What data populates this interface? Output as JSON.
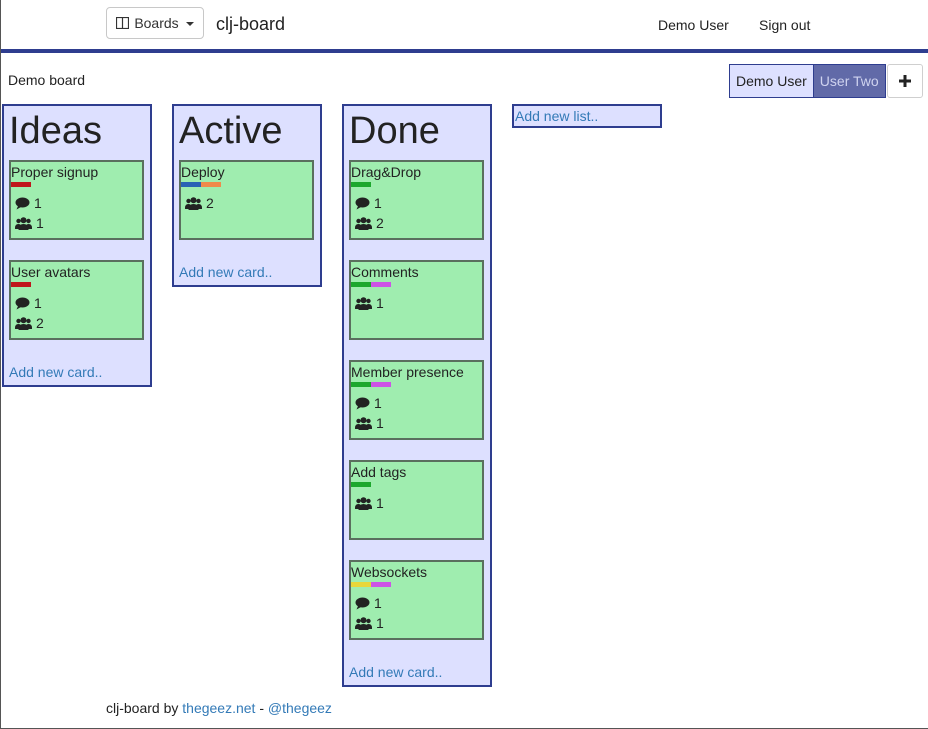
{
  "nav": {
    "boards_label": "Boards",
    "brand": "clj-board",
    "user_link": "Demo User",
    "signout_link": "Sign out"
  },
  "board": {
    "title": "Demo board",
    "members": [
      "Demo User",
      "User Two"
    ],
    "add_member_icon": "plus-icon",
    "add_list_label": "Add new list.."
  },
  "lists": [
    {
      "title": "Ideas",
      "add_card_label": "Add new card..",
      "cards": [
        {
          "title": "Proper signup",
          "tags": [
            "#c0161b"
          ],
          "comments": "1",
          "members": "1"
        },
        {
          "title": "User avatars",
          "tags": [
            "#c0161b"
          ],
          "comments": "1",
          "members": "2"
        }
      ]
    },
    {
      "title": "Active",
      "add_card_label": "Add new card..",
      "cards": [
        {
          "title": "Deploy",
          "tags": [
            "#2a62b5",
            "#f08a4b"
          ],
          "members": "2"
        }
      ]
    },
    {
      "title": "Done",
      "add_card_label": "Add new card..",
      "cards": [
        {
          "title": "Drag&Drop",
          "tags": [
            "#1ca72d"
          ],
          "comments": "1",
          "members": "2"
        },
        {
          "title": "Comments",
          "tags": [
            "#1ca72d",
            "#cd53e6"
          ],
          "members": "1"
        },
        {
          "title": "Member presence",
          "tags": [
            "#1ca72d",
            "#cd53e6"
          ],
          "comments": "1",
          "members": "1"
        },
        {
          "title": "Add tags",
          "tags": [
            "#1ca72d"
          ],
          "members": "1"
        },
        {
          "title": "Websockets",
          "tags": [
            "#e9d63a",
            "#cd53e6"
          ],
          "comments": "1",
          "members": "1"
        }
      ]
    }
  ],
  "footer": {
    "prefix": "clj-board by",
    "site_link": "thegeez.net",
    "separator": "-",
    "twitter_link": "@thegeez"
  },
  "colors": {
    "accent": "#2e3d8f",
    "list_bg": "#dde0ff",
    "card_bg": "#9fedaf",
    "link": "#337ab7"
  }
}
